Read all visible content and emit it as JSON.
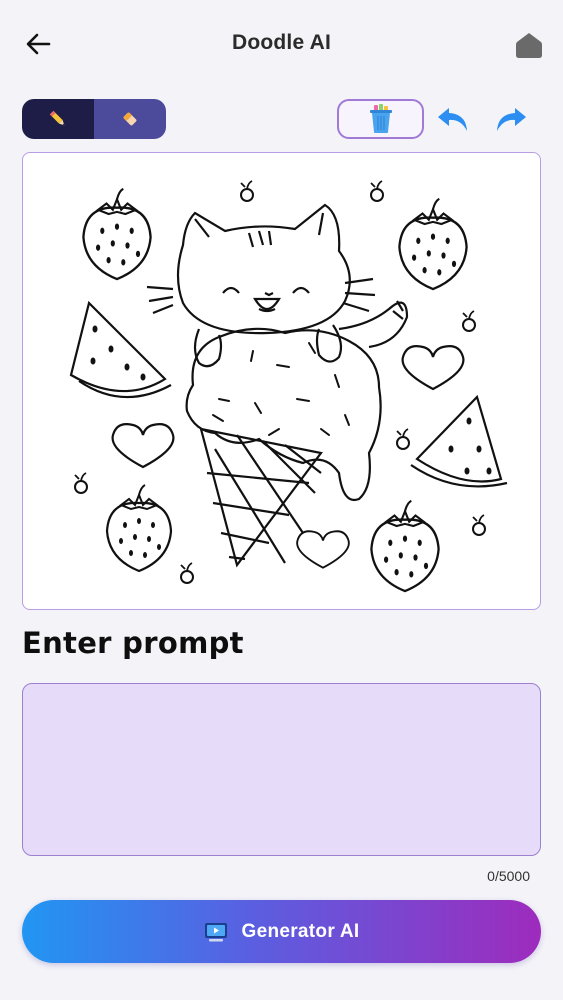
{
  "header": {
    "title": "Doodle AI",
    "back_icon": "arrow-left-icon",
    "home_icon": "home-icon"
  },
  "toolbar": {
    "tools": [
      {
        "name": "pencil",
        "icon": "pencil-icon",
        "selected": true
      },
      {
        "name": "eraser",
        "icon": "eraser-icon",
        "selected": false
      }
    ],
    "clear_icon": "trash-can-icon",
    "undo_icon": "undo-icon",
    "redo_icon": "redo-icon"
  },
  "canvas": {
    "content": "coloring-page-cat-on-ice-cream-with-strawberries-watermelon-hearts-cherries"
  },
  "prompt": {
    "heading": "Enter prompt",
    "value": "",
    "counter": "0/5000"
  },
  "generate": {
    "label": "Generator AI",
    "icon": "monitor-play-icon"
  },
  "colors": {
    "background": "#f3f3f8",
    "toggle_active": "#1d1d47",
    "toggle_inactive": "#4c4a9a",
    "accent_blue": "#2196f3",
    "accent_purple": "#9e2bbd",
    "prompt_fill": "#e6dcfa"
  }
}
